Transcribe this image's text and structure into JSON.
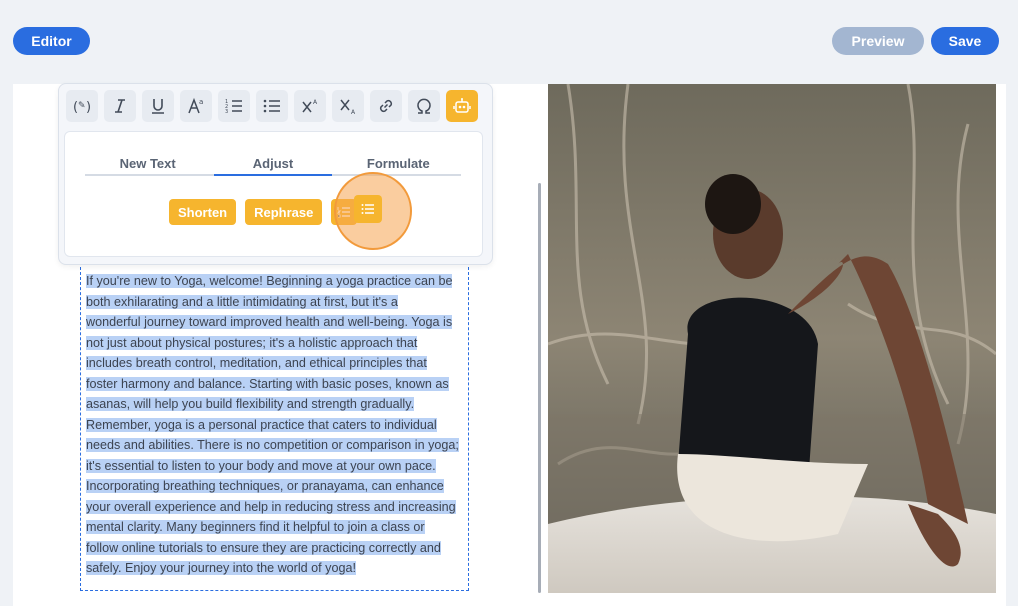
{
  "header": {
    "editor_label": "Editor",
    "preview_label": "Preview",
    "save_label": "Save"
  },
  "toolbar": {
    "tools": [
      {
        "icon": "ai-assist-icon",
        "glyph": "(✎)"
      },
      {
        "icon": "italic-icon",
        "glyph": "I"
      },
      {
        "icon": "underline-icon",
        "glyph": "U"
      },
      {
        "icon": "font-size-icon",
        "glyph": "A"
      },
      {
        "icon": "numbered-list-icon",
        "glyph": "≡"
      },
      {
        "icon": "bulleted-list-icon",
        "glyph": "≡"
      },
      {
        "icon": "superscript-icon",
        "glyph": "X"
      },
      {
        "icon": "subscript-icon",
        "glyph": "X"
      },
      {
        "icon": "link-icon",
        "glyph": "⚭"
      },
      {
        "icon": "special-character-icon",
        "glyph": "Ω"
      },
      {
        "icon": "robot-icon",
        "glyph": "🤖"
      }
    ]
  },
  "ai_panel": {
    "tabs": [
      "New Text",
      "Adjust",
      "Formulate"
    ],
    "active_tab": "Adjust",
    "shorten_label": "Shorten",
    "rephrase_label": "Rephrase"
  },
  "content": {
    "lines": [
      "If you're new to Yoga, welcome! Beginning a yoga practice can be",
      "both exhilarating and a little intimidating at first, but it's a",
      "wonderful journey toward improved health and well-being. Yoga is",
      "not just about physical postures; it's a holistic approach that",
      "includes breath control, meditation, and ethical principles that",
      "foster harmony and balance. Starting with basic poses, known as",
      "asanas, will help you build flexibility and strength gradually.",
      "Remember, yoga is a personal practice that caters to individual",
      "needs and abilities. There is no competition or comparison in yoga;",
      "it's essential to listen to your body and move at your own pace.",
      "Incorporating breathing techniques, or pranayama, can enhance",
      "your overall experience and help in reducing stress and increasing",
      "mental clarity. Many beginners find it helpful to join a class or",
      "follow online tutorials to ensure they are practicing correctly and",
      "safely. Enjoy your journey into the world of yoga!"
    ]
  },
  "colors": {
    "primary": "#2a6de0",
    "accent": "#f6b52e",
    "selection": "#b9d1f5",
    "background": "#eff2f6"
  }
}
